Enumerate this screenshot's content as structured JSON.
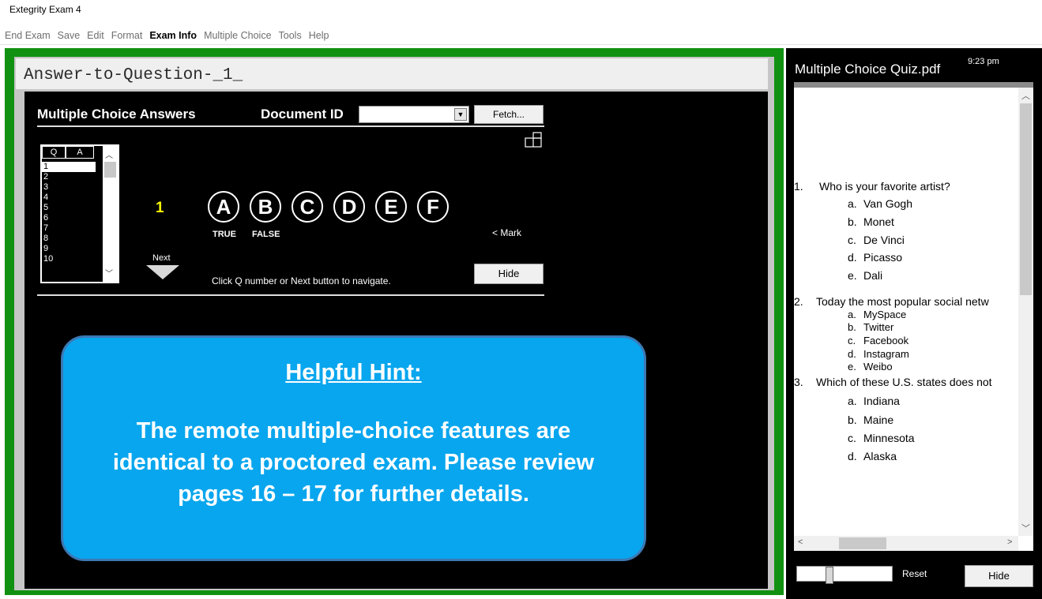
{
  "window": {
    "title": "Extegrity Exam 4"
  },
  "menu": [
    {
      "label": "End Exam",
      "active": false
    },
    {
      "label": "Save",
      "active": false
    },
    {
      "label": "Edit",
      "active": false
    },
    {
      "label": "Format",
      "active": false
    },
    {
      "label": "Exam Info",
      "active": true
    },
    {
      "label": "Multiple Choice",
      "active": false
    },
    {
      "label": "Tools",
      "active": false
    },
    {
      "label": "Help",
      "active": false
    }
  ],
  "document": {
    "title": "Answer-to-Question-_1_"
  },
  "mc_panel": {
    "title": "Multiple Choice Answers",
    "doc_id_label": "Document ID",
    "doc_id_value": "",
    "fetch_label": "Fetch...",
    "list_headers": [
      "Q",
      "A"
    ],
    "question_numbers": [
      "1",
      "2",
      "3",
      "4",
      "5",
      "6",
      "7",
      "8",
      "9",
      "10"
    ],
    "selected_question": "1",
    "current_question": "1",
    "choices": [
      "A",
      "B",
      "C",
      "D",
      "E",
      "F"
    ],
    "true_label": "TRUE",
    "false_label": "FALSE",
    "mark_label": "< Mark",
    "next_label": "Next",
    "nav_hint": "Click Q number or Next button to navigate.",
    "hide_label": "Hide"
  },
  "hint": {
    "title": "Helpful Hint:",
    "body": "The remote multiple-choice features are identical to a proctored exam. Please review pages 16 – 17 for further details."
  },
  "pdf_panel": {
    "title": "Multiple Choice Quiz.pdf",
    "time": "9:23 pm",
    "questions": [
      {
        "number": "1.",
        "text": "Who is your favorite artist?",
        "options": [
          {
            "letter": "a.",
            "text": "Van Gogh"
          },
          {
            "letter": "b.",
            "text": "Monet"
          },
          {
            "letter": "c.",
            "text": "De Vinci"
          },
          {
            "letter": "d.",
            "text": "Picasso"
          },
          {
            "letter": "e.",
            "text": "Dali"
          }
        ]
      },
      {
        "number": "2.",
        "text": "Today the most popular social netw",
        "options": [
          {
            "letter": "a.",
            "text": "MySpace"
          },
          {
            "letter": "b.",
            "text": "Twitter"
          },
          {
            "letter": "c.",
            "text": "Facebook"
          },
          {
            "letter": "d.",
            "text": "Instagram"
          },
          {
            "letter": "e.",
            "text": "Weibo"
          }
        ]
      },
      {
        "number": "3.",
        "text": "Which of these U.S. states does not",
        "options": [
          {
            "letter": "a.",
            "text": "Indiana"
          },
          {
            "letter": "b.",
            "text": "Maine"
          },
          {
            "letter": "c.",
            "text": "Minnesota"
          },
          {
            "letter": "d.",
            "text": "Alaska"
          }
        ]
      }
    ],
    "reset_label": "Reset",
    "hide_label": "Hide"
  },
  "colors": {
    "frame_green": "#119111",
    "hint_fill": "#08a6ee",
    "hint_border": "#3c78b4",
    "current_question": "#ffff00"
  },
  "icons": [
    "layout-icon",
    "dropdown-arrow-icon",
    "next-arrow-icon",
    "scroll-up-icon",
    "scroll-down-icon",
    "scroll-left-icon",
    "scroll-right-icon"
  ]
}
